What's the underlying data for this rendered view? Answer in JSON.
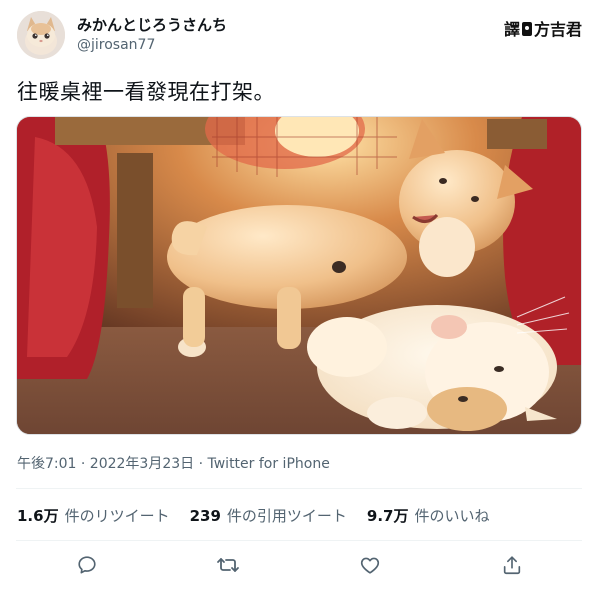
{
  "tweet": {
    "display_name": "みかんとじろうさんち",
    "handle": "@jirosan77",
    "text": "往暖桌裡一看發現在打架。",
    "timestamp": "午後7:01 · 2022年3月23日 · Twitter for iPhone",
    "avatar": "avatar-cat-photo"
  },
  "watermark": {
    "left": "譯",
    "right": "方吉君"
  },
  "media": {
    "description_icon": "photo-of-two-cats-fighting-under-kotatsu"
  },
  "stats": [
    {
      "count": "1.6万",
      "label": "件のリツイート"
    },
    {
      "count": "239",
      "label": "件の引用ツイート"
    },
    {
      "count": "9.7万",
      "label": "件のいいね"
    }
  ],
  "actions": [
    {
      "name": "reply",
      "icon": "reply-icon"
    },
    {
      "name": "retweet",
      "icon": "retweet-icon"
    },
    {
      "name": "like",
      "icon": "heart-icon"
    },
    {
      "name": "share",
      "icon": "share-icon"
    }
  ],
  "colors": {
    "text_primary": "#0f1419",
    "text_secondary": "#536471",
    "divider": "#eff3f4"
  }
}
